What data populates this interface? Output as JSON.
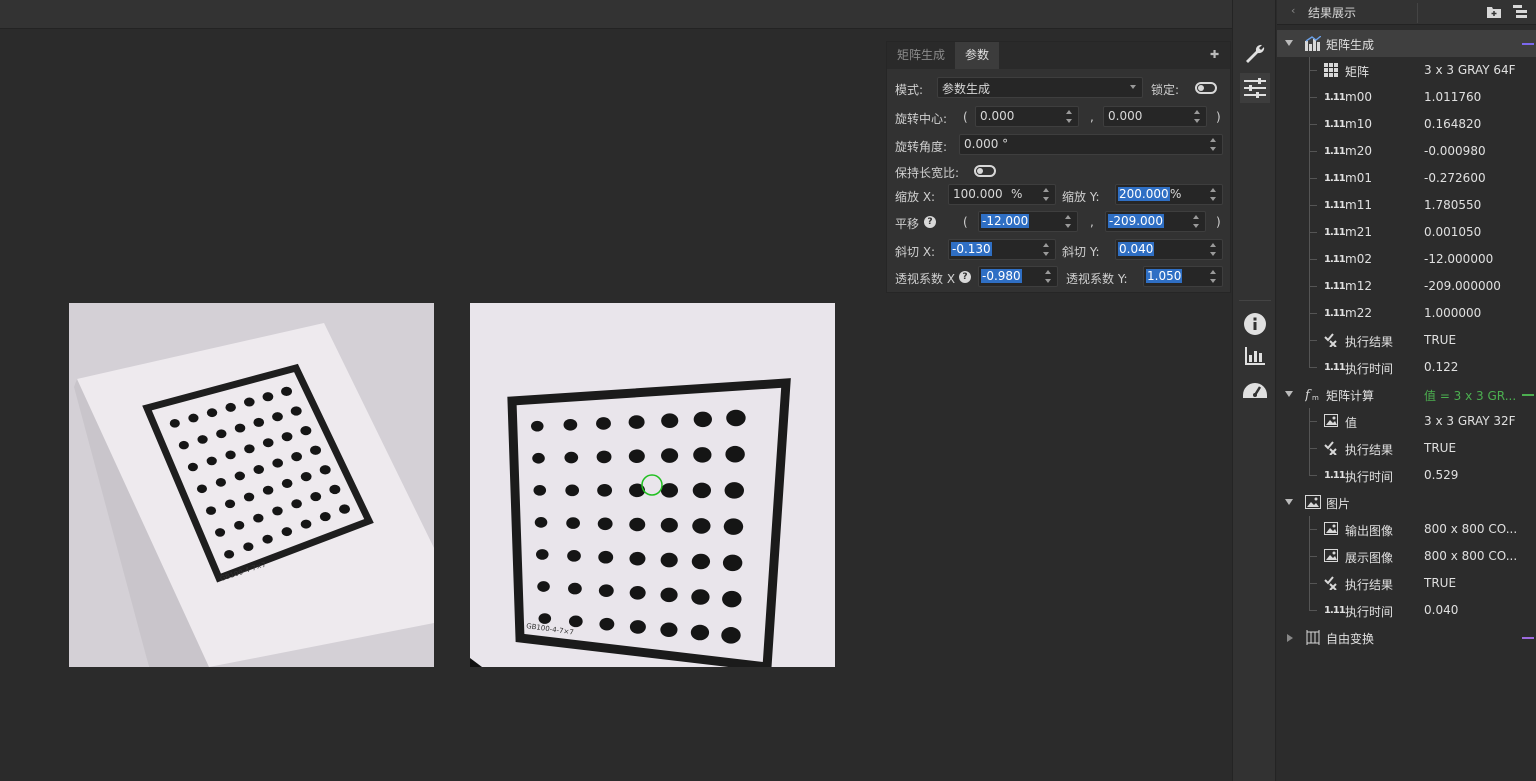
{
  "param_panel": {
    "tabs": [
      "矩阵生成",
      "参数"
    ],
    "mode_label": "模式:",
    "mode_value": "参数生成",
    "lock_label": "锁定:",
    "rot_center_label": "旋转中心:",
    "rot_center_x": "0.000",
    "rot_center_y": "0.000",
    "paren_open": "(",
    "paren_close": ")",
    "comma": ",",
    "rot_angle_label": "旋转角度:",
    "rot_angle_value": "0.000 °",
    "keep_ratio_label": "保持长宽比:",
    "scale_x_label": "缩放 X:",
    "scale_x_value": "100.000",
    "scale_y_label": "缩放 Y:",
    "scale_y_value": "200.000",
    "percent": "%",
    "translate_label": "平移",
    "translate_x": "-12.000",
    "translate_y": "-209.000",
    "shear_x_label": "斜切 X:",
    "shear_x_value": "-0.130",
    "shear_y_label": "斜切 Y:",
    "shear_y_value": "0.040",
    "persp_x_label": "透视系数 X",
    "persp_x_value": "-0.980",
    "persp_y_label": "透视系数 Y:",
    "persp_y_value": "1.050"
  },
  "results": {
    "title": "结果展示",
    "groups": [
      {
        "name": "矩阵生成",
        "items": [
          {
            "name": "矩阵",
            "value": "3 x 3 GRAY 64F",
            "icon": "grid-icon"
          },
          {
            "name": "m00",
            "value": "1.011760",
            "icon": "number-icon"
          },
          {
            "name": "m10",
            "value": "0.164820",
            "icon": "number-icon"
          },
          {
            "name": "m20",
            "value": "-0.000980",
            "icon": "number-icon"
          },
          {
            "name": "m01",
            "value": "-0.272600",
            "icon": "number-icon"
          },
          {
            "name": "m11",
            "value": "1.780550",
            "icon": "number-icon"
          },
          {
            "name": "m21",
            "value": "0.001050",
            "icon": "number-icon"
          },
          {
            "name": "m02",
            "value": "-12.000000",
            "icon": "number-icon"
          },
          {
            "name": "m12",
            "value": "-209.000000",
            "icon": "number-icon"
          },
          {
            "name": "m22",
            "value": "1.000000",
            "icon": "number-icon"
          },
          {
            "name": "执行结果",
            "value": "TRUE",
            "icon": "result-icon"
          },
          {
            "name": "执行时间",
            "value": "0.122",
            "icon": "number-icon"
          }
        ]
      },
      {
        "name": "矩阵计算",
        "value": "值 = 3 x 3 GR...",
        "items": [
          {
            "name": "值",
            "value": "3 x 3 GRAY 32F",
            "icon": "image-icon"
          },
          {
            "name": "执行结果",
            "value": "TRUE",
            "icon": "result-icon"
          },
          {
            "name": "执行时间",
            "value": "0.529",
            "icon": "number-icon"
          }
        ]
      },
      {
        "name": "图片",
        "items": [
          {
            "name": "输出图像",
            "value": "800 x 800 CO...",
            "icon": "image-icon"
          },
          {
            "name": "展示图像",
            "value": "800 x 800 CO...",
            "icon": "image-icon"
          },
          {
            "name": "执行结果",
            "value": "TRUE",
            "icon": "result-icon"
          },
          {
            "name": "执行时间",
            "value": "0.040",
            "icon": "number-icon"
          }
        ]
      },
      {
        "name": "自由变换",
        "items": []
      }
    ]
  },
  "number_icon_text": "1.11",
  "images": {
    "left_caption": "GB100-4-7×7",
    "right_caption": "GB100-4-7×7"
  },
  "colors": {
    "accent_select": "#2f6fc4",
    "green_value": "#4caf50",
    "marker_green": "#22c022"
  }
}
